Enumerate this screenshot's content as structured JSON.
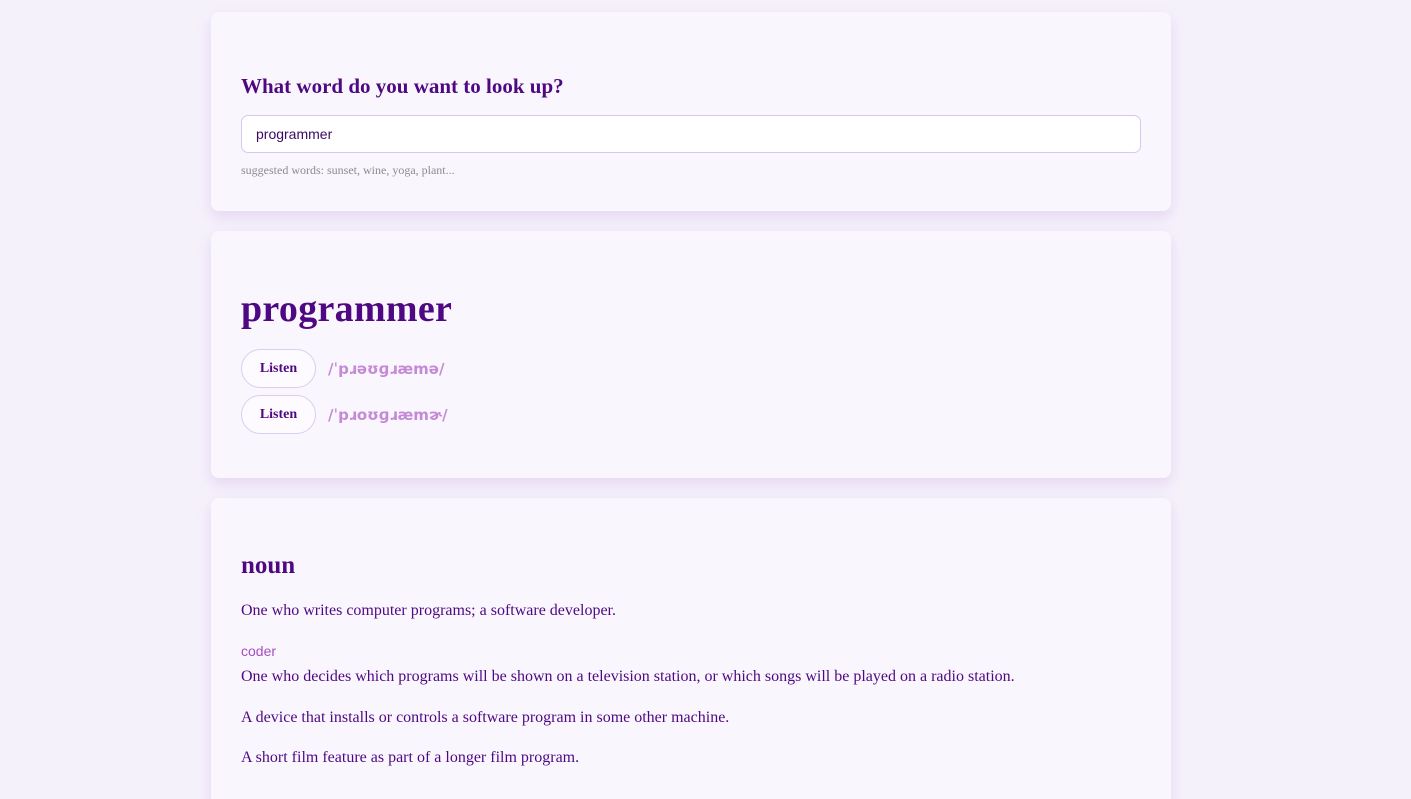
{
  "search": {
    "title": "What word do you want to look up?",
    "value": "programmer",
    "hint": "suggested words: sunset, wine, yoga, plant..."
  },
  "word": {
    "headword": "programmer",
    "phonetics": [
      {
        "button_label": "Listen",
        "text": "/ˈpɹəʊɡɹæmə/"
      },
      {
        "button_label": "Listen",
        "text": "/ˈpɹoʊɡɹæmɚ/"
      }
    ]
  },
  "meaning": {
    "part_of_speech": "noun",
    "definitions": [
      "One who writes computer programs; a software developer.",
      "One who decides which programs will be shown on a television station, or which songs will be played on a radio station.",
      "A device that installs or controls a software program in some other machine.",
      "A short film feature as part of a longer film program."
    ],
    "synonym": "coder"
  },
  "colors": {
    "background": "#f5f1fb",
    "card": "#faf6fd",
    "primary_text": "#4e0982",
    "phonetic": "#c58ad6",
    "synonym": "#a44fc0",
    "hint": "#8d8a92"
  }
}
